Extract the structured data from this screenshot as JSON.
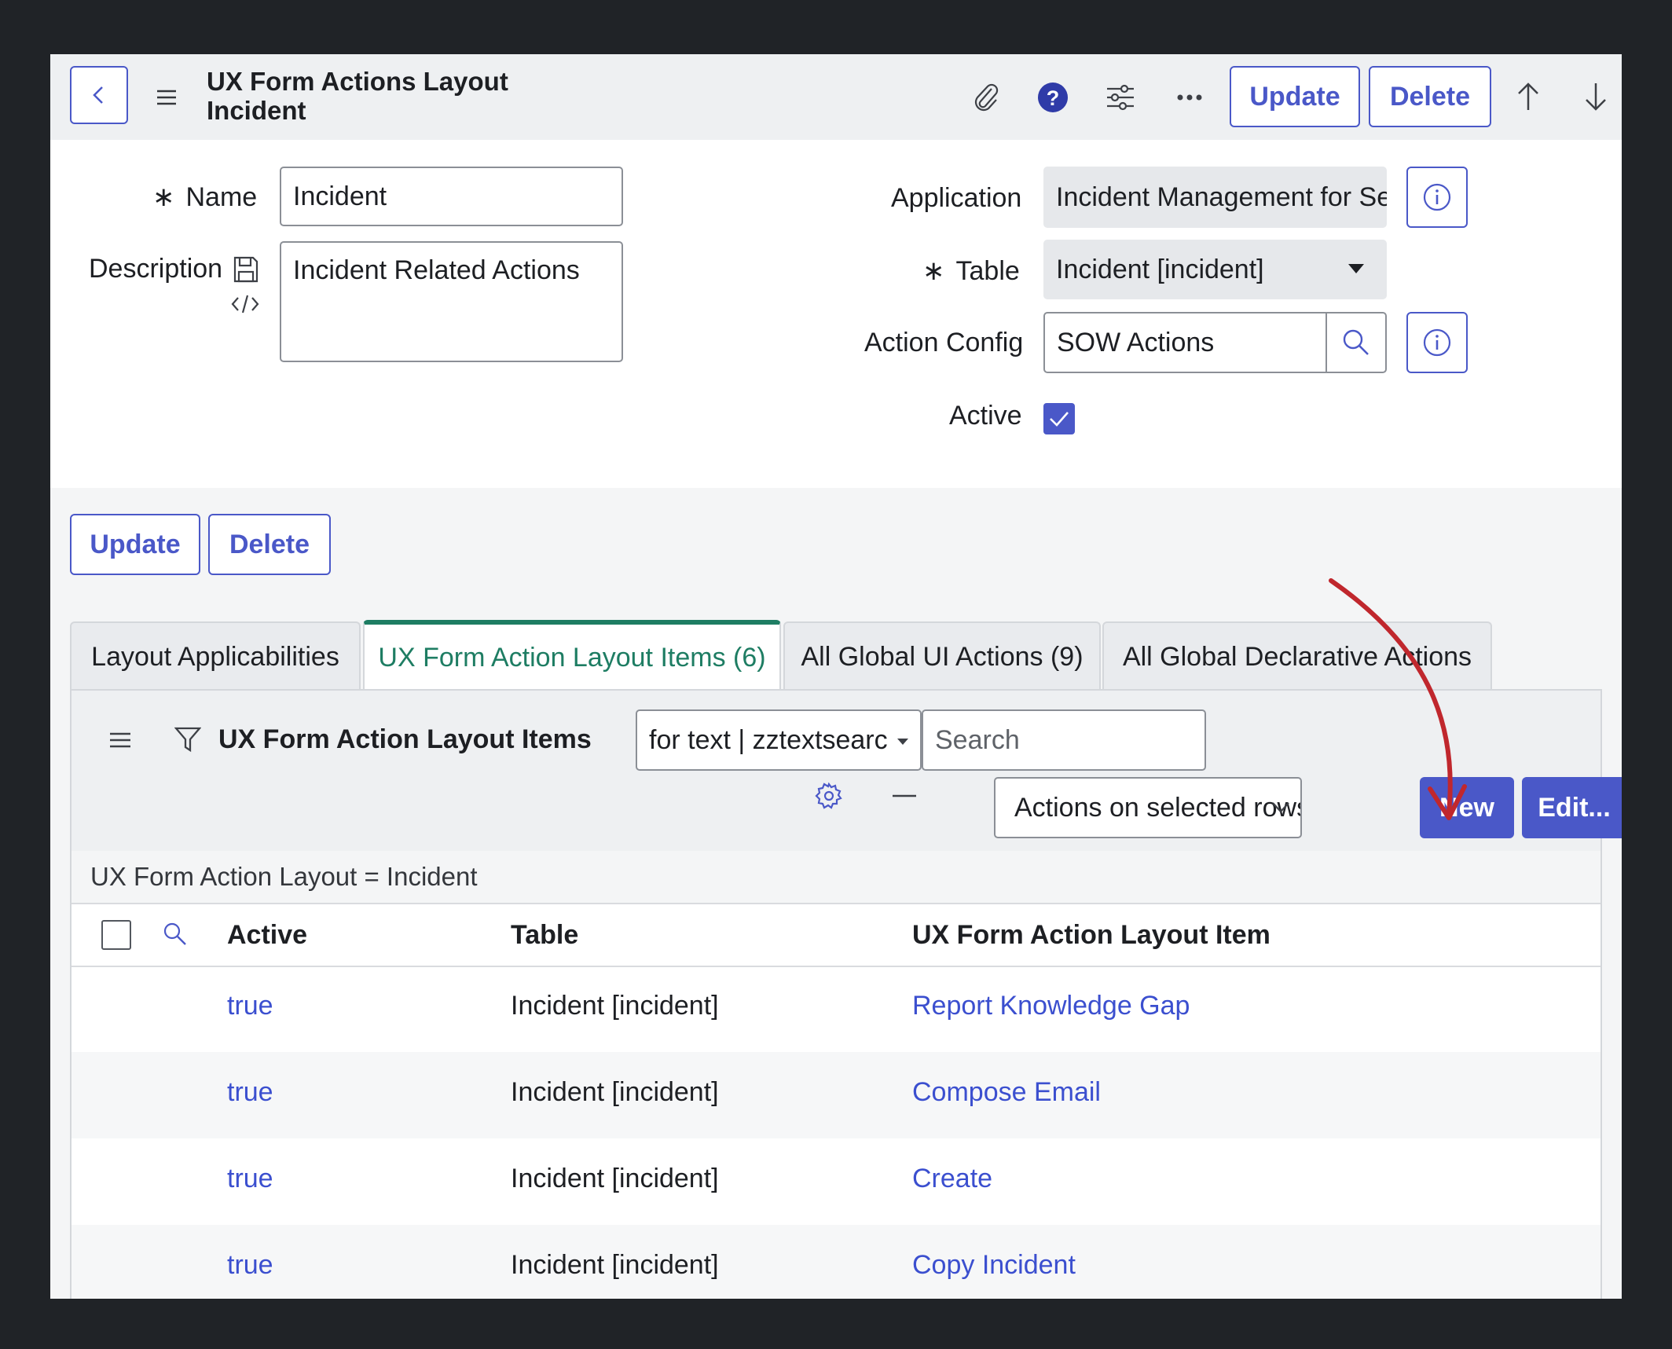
{
  "header": {
    "title_line1": "UX Form Actions Layout",
    "title_line2": "Incident",
    "update_label": "Update",
    "delete_label": "Delete"
  },
  "form": {
    "name_label": "Name",
    "name_value": "Incident",
    "description_label": "Description",
    "description_value": "Incident Related Actions",
    "application_label": "Application",
    "application_value": "Incident Management for Se",
    "table_label": "Table",
    "table_value": "Incident [incident]",
    "action_config_label": "Action Config",
    "action_config_value": "SOW Actions",
    "active_label": "Active",
    "active_checked": true
  },
  "form_buttons": {
    "update_label": "Update",
    "delete_label": "Delete"
  },
  "tabs": [
    {
      "label": "Layout Applicabilities",
      "active": false
    },
    {
      "label": "UX Form Action Layout Items (6)",
      "active": true
    },
    {
      "label": "All Global UI Actions (9)",
      "active": false
    },
    {
      "label": "All Global Declarative Actions",
      "active": false
    }
  ],
  "list": {
    "title": "UX Form Action Layout Items",
    "search_field_value": "for text | zztextsearc",
    "search_placeholder": "Search",
    "actions_select_value": "Actions on selected rows... | x",
    "new_label": "New",
    "edit_label": "Edit...",
    "filter_text": "UX Form Action Layout = Incident",
    "columns": [
      "Active",
      "Table",
      "UX Form Action Layout Item"
    ],
    "rows": [
      {
        "active": "true",
        "table": "Incident [incident]",
        "item": "Report Knowledge Gap"
      },
      {
        "active": "true",
        "table": "Incident [incident]",
        "item": "Compose Email"
      },
      {
        "active": "true",
        "table": "Incident [incident]",
        "item": "Create"
      },
      {
        "active": "true",
        "table": "Incident [incident]",
        "item": "Copy Incident"
      }
    ]
  },
  "colors": {
    "accent": "#4a58c8",
    "tab_active": "#1e7d63",
    "link": "#3b4fcf",
    "annotation_arrow": "#c0272d",
    "backdrop": "#202327"
  }
}
